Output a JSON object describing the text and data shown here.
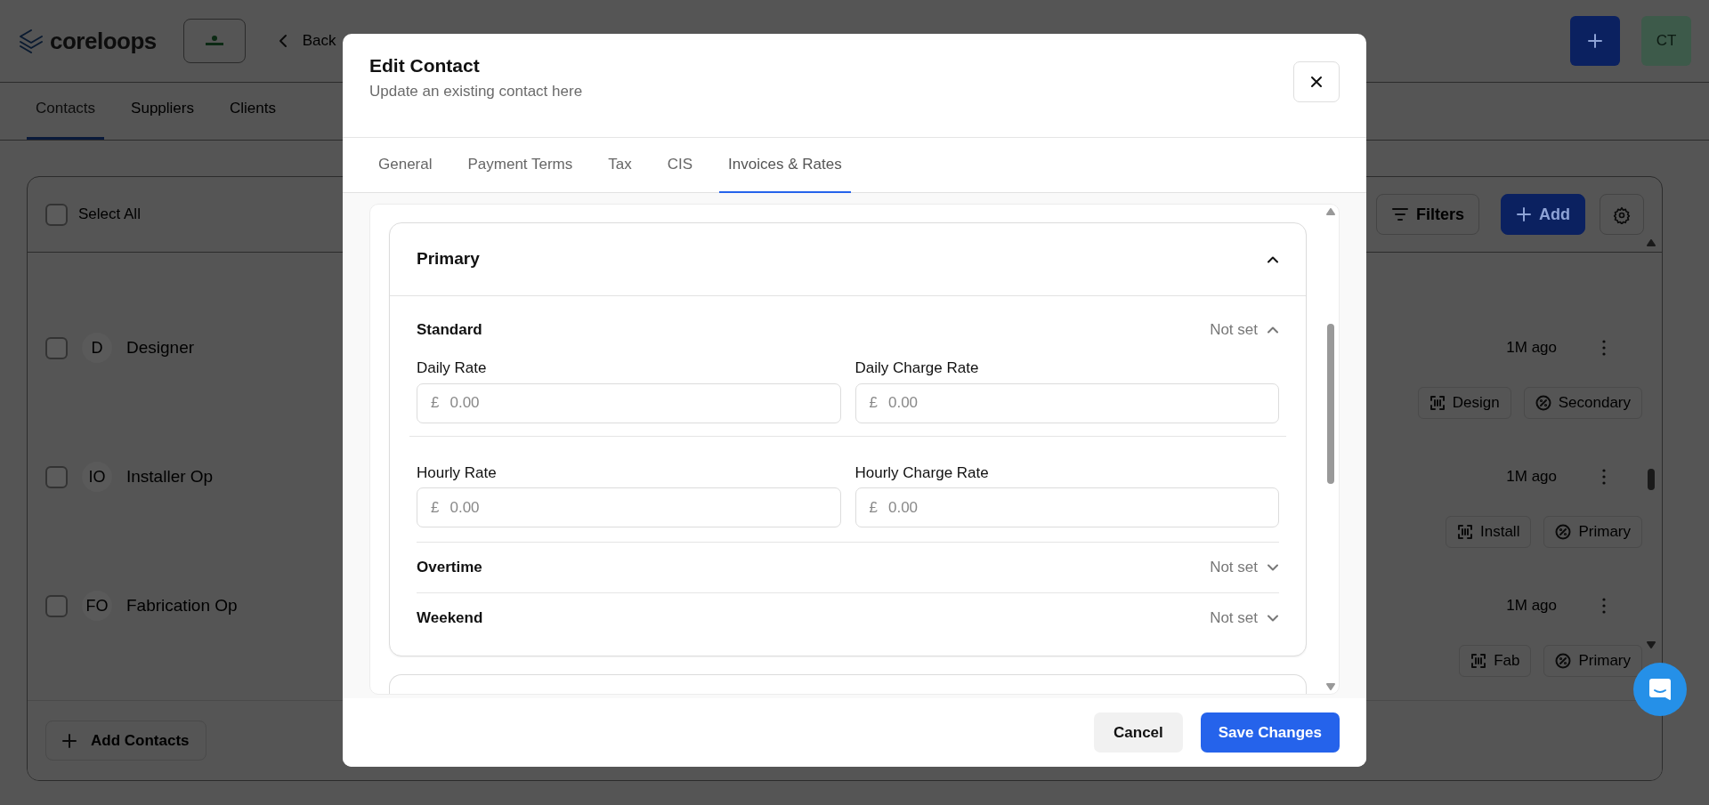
{
  "app": {
    "logo": "coreloops",
    "back_link": "Back",
    "avatar": "CT"
  },
  "page_tabs": [
    {
      "label": "Contacts",
      "selected": true
    },
    {
      "label": "Suppliers",
      "selected": false
    },
    {
      "label": "Clients",
      "selected": false
    }
  ],
  "list_toolbar": {
    "select_all": {
      "label": "Select All",
      "checked": false
    },
    "filters": "Filters",
    "add": "Add"
  },
  "contacts": [
    {
      "initials": "D",
      "name": "Designer",
      "time": "1M ago",
      "checked": false,
      "tags": [
        {
          "kind": "trade",
          "label": "Design"
        },
        {
          "kind": "priority",
          "label": "Secondary"
        }
      ]
    },
    {
      "initials": "IO",
      "name": "Installer Op",
      "time": "1M ago",
      "checked": false,
      "tags": [
        {
          "kind": "trade",
          "label": "Install"
        },
        {
          "kind": "priority",
          "label": "Primary"
        }
      ]
    },
    {
      "initials": "FO",
      "name": "Fabrication Op",
      "time": "1M ago",
      "checked": false,
      "tags": [
        {
          "kind": "trade",
          "label": "Fab"
        },
        {
          "kind": "priority",
          "label": "Primary"
        }
      ]
    }
  ],
  "add_contacts_button": "Add Contacts",
  "modal": {
    "title": "Edit Contact",
    "subtitle": "Update an existing contact here",
    "tabs": [
      {
        "label": "General",
        "selected": false
      },
      {
        "label": "Payment Terms",
        "selected": false
      },
      {
        "label": "Tax",
        "selected": false
      },
      {
        "label": "CIS",
        "selected": false
      },
      {
        "label": "Invoices & Rates",
        "selected": true
      }
    ],
    "rate_groups": [
      {
        "title": "Primary",
        "expanded": true,
        "sections": [
          {
            "title": "Standard",
            "status": "Not set",
            "expanded": true,
            "fields": [
              {
                "label": "Daily Rate",
                "currency": "£",
                "placeholder": "0.00"
              },
              {
                "label": "Daily Charge Rate",
                "currency": "£",
                "placeholder": "0.00"
              },
              {
                "label": "Hourly Rate",
                "currency": "£",
                "placeholder": "0.00"
              },
              {
                "label": "Hourly Charge Rate",
                "currency": "£",
                "placeholder": "0.00"
              }
            ]
          },
          {
            "title": "Overtime",
            "status": "Not set",
            "expanded": false
          },
          {
            "title": "Weekend",
            "status": "Not set",
            "expanded": false
          }
        ]
      }
    ],
    "cancel": "Cancel",
    "save": "Save Changes"
  }
}
